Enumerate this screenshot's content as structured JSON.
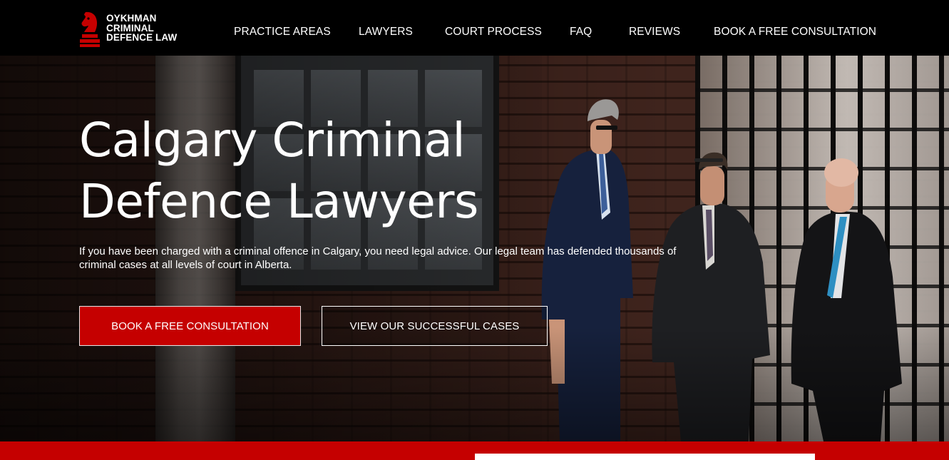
{
  "header": {
    "logo": {
      "lines": [
        "OYKHMAN",
        "CRIMINAL",
        "DEFENCE LAW"
      ],
      "icon": "chess-knight-icon",
      "brand_color": "#c50000"
    },
    "nav": [
      {
        "label": "PRACTICE AREAS"
      },
      {
        "label": "LAWYERS"
      },
      {
        "label": "COURT PROCESS"
      },
      {
        "label": "FAQ"
      },
      {
        "label": "REVIEWS"
      },
      {
        "label": "BOOK A FREE CONSULTATION"
      }
    ]
  },
  "hero": {
    "title_lines": [
      "Calgary Criminal",
      "Defence Lawyers"
    ],
    "text": "If you have been charged with a criminal offence in Calgary, you need legal advice. Our legal team has defended thousands of criminal cases at all levels of court in Alberta.",
    "primary_button": "BOOK A FREE CONSULTATION",
    "secondary_button": "VIEW OUR SUCCESSFUL CASES",
    "accent_color": "#c50000"
  }
}
